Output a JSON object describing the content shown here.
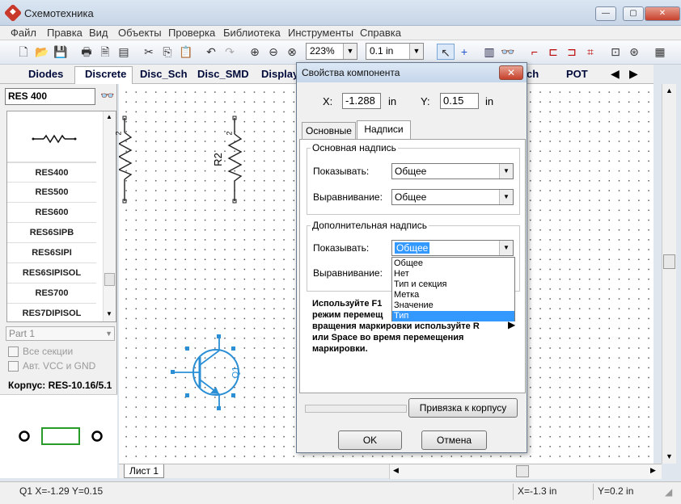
{
  "window": {
    "title": "Схемотехника"
  },
  "menu": [
    "Файл",
    "Правка",
    "Вид",
    "Объекты",
    "Проверка",
    "Библиотека",
    "Инструменты",
    "Справка"
  ],
  "toolbar": {
    "zoom": "223%",
    "grid": "0.1 in"
  },
  "component_tabs": [
    "Diodes",
    "Discrete",
    "Disc_Sch",
    "Disc_SMD",
    "Display",
    "ch",
    "POT"
  ],
  "library": {
    "search": "RES 400",
    "items": [
      "RES400",
      "RES500",
      "RES600",
      "RES6SIPB",
      "RES6SIPI",
      "RES6SIPISOL",
      "RES700",
      "RES7DIPISOL"
    ],
    "part": "Part 1",
    "all_sections": "Все секции",
    "auto_vcc": "Авт. VCC и GND",
    "package": "Корпус: RES-10.16/5.1"
  },
  "canvas": {
    "r2_label": "R2",
    "q1_label": "Q1",
    "pin_2": "2",
    "pin_2b": "2"
  },
  "sheet_tab": "Лист 1",
  "status": {
    "left": "Q1  X=-1.29  Y=0.15",
    "x": "X=-1.3 in",
    "y": "Y=0.2 in"
  },
  "dialog": {
    "title": "Свойства компонента",
    "x_label": "X:",
    "x_value": "-1.288",
    "x_unit": "in",
    "y_label": "Y:",
    "y_value": "0.15",
    "y_unit": "in",
    "tabs": [
      "Основные",
      "Надписи"
    ],
    "main_group": "Основная надпись",
    "show_label": "Показывать:",
    "align_label": "Выравнивание:",
    "main_show": "Общее",
    "main_align": "Общее",
    "extra_group": "Дополнительная надпись",
    "extra_show_label": "Показывать:",
    "extra_show": "Общее",
    "extra_align_label": "Выравнивание:",
    "options": [
      "Общее",
      "Нет",
      "Тип и секция",
      "Метка",
      "Значение",
      "Тип"
    ],
    "hint_lines": [
      "Используйте F1",
      "режим перемещ",
      "вращения маркировки используйте R",
      "или Space во время перемещения",
      "маркировки."
    ],
    "bind_button": "Привязка к корпусу",
    "ok": "OK",
    "cancel": "Отмена"
  }
}
